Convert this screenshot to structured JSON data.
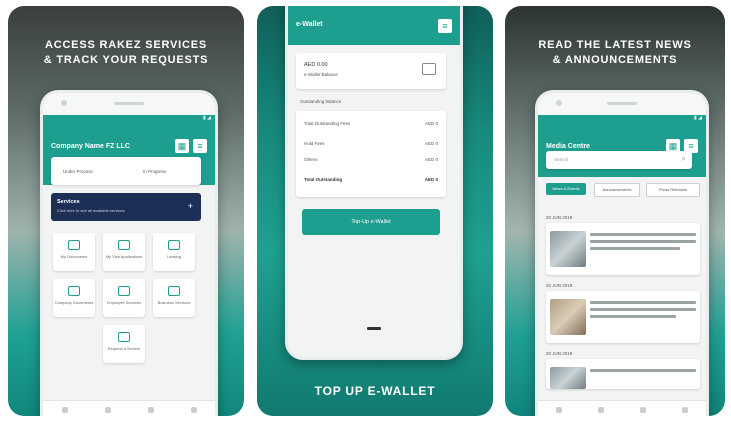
{
  "screens": [
    {
      "caption_line1": "ACCESS RAKEZ SERVICES",
      "caption_line2": "& TRACK YOUR REQUESTS",
      "app_title": "Company Name FZ LLC",
      "info_left": "Under Process",
      "info_right": "In Progress",
      "banner_title": "Services",
      "banner_sub": "Click here to see all available services",
      "tiles": [
        "My Documents",
        "My Visa Applications",
        "Leasing",
        "Company Documents",
        "Employee Services",
        "Business Services",
        "Request a Service"
      ]
    },
    {
      "caption": "TOP UP E-WALLET",
      "app_title": "e-Wallet",
      "balance_label": "AED 0.00",
      "balance_sub": "e-Wallet Balance",
      "section_title": "Outstanding balance",
      "rows": [
        {
          "label": "Total Outstanding Fees",
          "value": "AED 0"
        },
        {
          "label": "Hold Fees",
          "value": "AED 0"
        },
        {
          "label": "Others",
          "value": "AED 0"
        },
        {
          "label": "Total Outstanding",
          "value": "AED 0"
        }
      ],
      "button_label": "Top-Up e-Wallet"
    },
    {
      "caption_line1": "READ THE LATEST NEWS",
      "caption_line2": "& ANNOUNCEMENTS",
      "app_title": "Media Centre",
      "search_placeholder": "Search",
      "chips": [
        "News & Events",
        "Announcements",
        "Press Releases"
      ],
      "news_dates": [
        "20 JUN 2019",
        "20 JUN 2019",
        "20 JUN 2019"
      ]
    }
  ],
  "colors": {
    "primary": "#1e9e8f",
    "navy": "#1d2f57"
  }
}
